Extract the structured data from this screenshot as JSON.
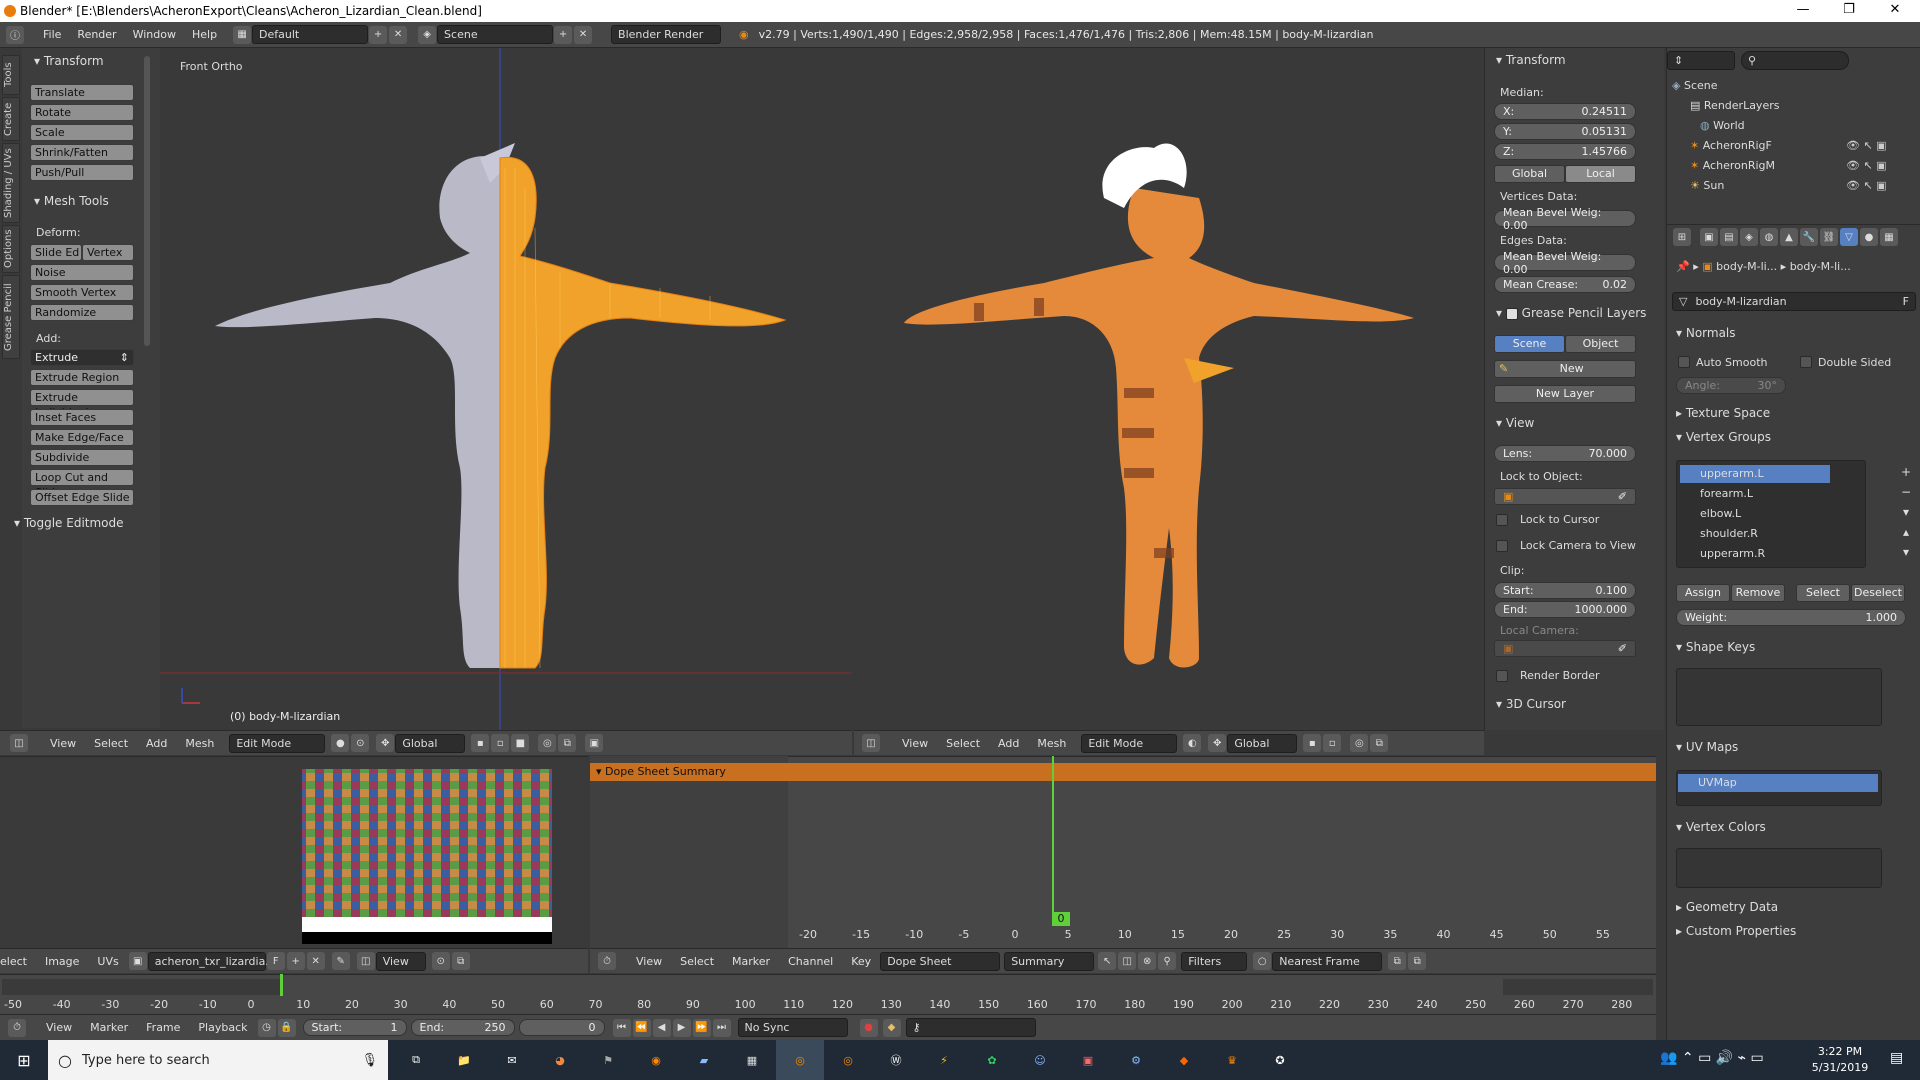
{
  "window": {
    "title": "Blender* [E:\\Blenders\\AcheronExport\\Cleans\\Acheron_Lizardian_Clean.blend]",
    "min": "—",
    "max": "❐",
    "close": "✕"
  },
  "topbar": {
    "menus": [
      "File",
      "Render",
      "Window",
      "Help"
    ],
    "layout": "Default",
    "scene": "Scene",
    "engine": "Blender Render",
    "stats": "v2.79 | Verts:1,490/1,490 | Edges:2,958/2,958 | Faces:1,476/1,476 | Tris:2,806 | Mem:48.15M | body-M-lizardian"
  },
  "left_tabs": [
    "Tools",
    "Create",
    "Shading / UVs",
    "Options",
    "Grease Pencil"
  ],
  "toolshelf": {
    "transform_title": "Transform",
    "transform_buttons": [
      "Translate",
      "Rotate",
      "Scale",
      "Shrink/Fatten",
      "Push/Pull"
    ],
    "meshtools_title": "Mesh Tools",
    "deform_label": "Deform:",
    "slide_edge": "Slide Ed",
    "vertex": "Vertex",
    "deform_buttons": [
      "Noise",
      "Smooth Vertex",
      "Randomize"
    ],
    "add_label": "Add:",
    "extrude": "Extrude",
    "add_buttons": [
      "Extrude Region",
      "Extrude Individual",
      "Inset Faces",
      "Make Edge/Face",
      "Subdivide",
      "Loop Cut and Slide",
      "Offset Edge Slide"
    ],
    "toggle_editmode": "Toggle Editmode"
  },
  "viewport_left": {
    "view_label": "Front Ortho",
    "object_label": "(0) body-M-lizardian",
    "header": {
      "menus": [
        "View",
        "Select",
        "Add",
        "Mesh"
      ],
      "mode": "Edit Mode",
      "orientation": "Global"
    }
  },
  "viewport_right": {
    "header": {
      "menus": [
        "View",
        "Select",
        "Add",
        "Mesh"
      ],
      "mode": "Edit Mode",
      "orientation": "Global"
    }
  },
  "n_panel": {
    "transform_title": "Transform",
    "median": "Median:",
    "x_label": "X:",
    "x_value": "0.24511",
    "y_label": "Y:",
    "y_value": "0.05131",
    "z_label": "Z:",
    "z_value": "1.45766",
    "global": "Global",
    "local": "Local",
    "vertices_data": "Vertices Data:",
    "mean_bevel_v": "Mean Bevel Weig: 0.00",
    "edges_data": "Edges Data:",
    "mean_bevel_e": "Mean Bevel Weig: 0.00",
    "mean_crease_label": "Mean Crease:",
    "mean_crease_value": "0.02",
    "grease_title": "Grease Pencil Layers",
    "scene": "Scene",
    "object": "Object",
    "new": "New",
    "new_layer": "New Layer",
    "view_title": "View",
    "lens_label": "Lens:",
    "lens_value": "70.000",
    "lock_to_object": "Lock to Object:",
    "lock_to_cursor": "Lock to Cursor",
    "lock_camera": "Lock Camera to View",
    "clip": "Clip:",
    "start_label": "Start:",
    "start_value": "0.100",
    "end_label": "End:",
    "end_value": "1000.000",
    "local_camera": "Local Camera:",
    "render_border": "Render Border",
    "cursor_title": "3D Cursor"
  },
  "outliner": {
    "rows": [
      {
        "icon": "scene-icon",
        "label": "Scene"
      },
      {
        "icon": "renderlayers-icon",
        "label": "RenderLayers"
      },
      {
        "icon": "world-icon",
        "label": "World"
      },
      {
        "icon": "armature-icon",
        "label": "AcheronRigF"
      },
      {
        "icon": "armature-icon",
        "label": "AcheronRigM"
      },
      {
        "icon": "sun-icon",
        "label": "Sun"
      }
    ]
  },
  "properties": {
    "breadcrumb_a": "body-M-li...",
    "breadcrumb_b": "body-M-li...",
    "mesh_name": "body-M-lizardian",
    "fake_user": "F",
    "normals_title": "Normals",
    "auto_smooth": "Auto Smooth",
    "double_sided": "Double Sided",
    "angle": "Angle:",
    "angle_value": "30°",
    "texture_space": "Texture Space",
    "vertex_groups_title": "Vertex Groups",
    "vertex_groups": [
      "upperarm.L",
      "forearm.L",
      "elbow.L",
      "shoulder.R",
      "upperarm.R"
    ],
    "assign": "Assign",
    "remove": "Remove",
    "select": "Select",
    "deselect": "Deselect",
    "weight_label": "Weight:",
    "weight_value": "1.000",
    "shape_keys_title": "Shape Keys",
    "uv_maps_title": "UV Maps",
    "uv_map": "UVMap",
    "vertex_colors_title": "Vertex Colors",
    "geometry_data": "Geometry Data",
    "custom_properties": "Custom Properties"
  },
  "image_editor": {
    "menus": [
      "elect",
      "Image",
      "UVs"
    ],
    "image_name": "acheron_txr_lizardia...",
    "fake_user": "F",
    "view": "View"
  },
  "dopesheet": {
    "summary_channel": "Dope Sheet Summary",
    "menus": [
      "View",
      "Select",
      "Marker",
      "Channel",
      "Key"
    ],
    "mode": "Dope Sheet",
    "summary": "Summary",
    "filters": "Filters",
    "snap": "Nearest Frame",
    "current_frame_badge": "0",
    "ticks": [
      "-20",
      "-15",
      "-10",
      "-5",
      "0",
      "5",
      "10",
      "15",
      "20",
      "25",
      "30",
      "35",
      "40",
      "45",
      "50",
      "55"
    ]
  },
  "timeline": {
    "ticks": [
      "-50",
      "-40",
      "-30",
      "-20",
      "-10",
      "0",
      "10",
      "20",
      "30",
      "40",
      "50",
      "60",
      "70",
      "80",
      "90",
      "100",
      "110",
      "120",
      "130",
      "140",
      "150",
      "160",
      "170",
      "180",
      "190",
      "200",
      "210",
      "220",
      "230",
      "240",
      "250",
      "260",
      "270",
      "280"
    ],
    "menus": [
      "View",
      "Marker",
      "Frame",
      "Playback"
    ],
    "start_label": "Start:",
    "start_value": "1",
    "end_label": "End:",
    "end_value": "250",
    "current": "0",
    "sync": "No Sync"
  },
  "taskbar": {
    "search_placeholder": "Type here to search",
    "time": "3:22 PM",
    "date": "5/31/2019"
  },
  "colors": {
    "accent_blue": "#5680c2",
    "orange": "#e98a18",
    "green_playhead": "#5fcf3a"
  }
}
